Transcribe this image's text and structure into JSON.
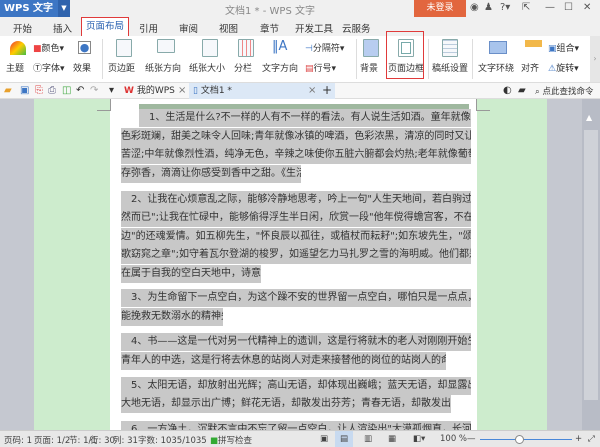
{
  "app": {
    "name": "WPS 文字",
    "title": "文档1 * - WPS 文字",
    "login": "未登录"
  },
  "tabs": [
    "开始",
    "插入",
    "页面布局",
    "引用",
    "审阅",
    "视图",
    "章节",
    "开发工具",
    "云服务"
  ],
  "ribbon": {
    "theme": "主题",
    "color": "颜色",
    "font": "字体",
    "effect": "效果",
    "margin": "页边距",
    "orientation": "纸张方向",
    "size": "纸张大小",
    "columns": "分栏",
    "text_direction": "文字方向",
    "separator": "分隔符",
    "line_number": "行号",
    "background": "背景",
    "page_border": "页面边框",
    "manuscript": "稿纸设置",
    "wrap": "文字环绕",
    "align": "对齐",
    "group": "组合",
    "rotate": "旋转"
  },
  "doc_tabs": {
    "my_wps": "我的WPS",
    "doc": "文档1 *",
    "search_placeholder": "点此查找命令"
  },
  "document": {
    "lines": [
      "　1、生活是什么?不一样的人有不一样的看法。有人说生活如酒。童年就像鸡尾酒，",
      "色彩斑斓，甜美之味令人回味;青年就像冰镇的啤酒，色彩浓黑，清凉的同时又让人觉得",
      "苦涩;中年就像烈性酒，纯净无色，辛辣之味使你五脏六腑都会灼热;老年就像葡萄酒，久",
      "存弥香，滴滴让你感受到香中之甜。《生活是什么》",
      "　2、让我在心烦意乱之际，能够冷静地思考，吟上一句\"人生天地间，若白驹过隙，忽",
      "然而已\";让我在忙碌中，能够偷得浮生半日闲，欣赏一段\"他年傥得蟾宫客，不在梅边在柳",
      "边\"的还魂爱情。如五柳先生，\"怀良辰以孤往，或植杖而耘耔\";如东坡先生，\"颂明月之诗，",
      "歌窈窕之章\";如守着瓦尔登湖的梭罗，如遥望乞力马扎罗之雪的海明威。他们都是诗人，",
      "在属于自我的空白天地中，诗意地栖居。",
      "　3、为生命留下一点空白，为这个躁不安的世界留一点空白，哪怕只是一点点，却",
      "能挽救无数溺水的精神失陷者。",
      "　4、书——这是一代对另一代精神上的遗训，这是行将就木的老人对刚刚开始生活的",
      "青年人的中选，这是行将去休息的站岗人对走来接替他的岗位的站岗人的命令。",
      "　5、太阳无语，却放射出光辉；高山无语，却体现出巍峨；蓝天无语，却显露出高远；",
      "大地无语，却显示出广博；鲜花无语，却散发出芬芳；青春无语，却散发出活力。",
      "　6、一方净土，沉默不言中不忘了留一点空白，让人渲染出\"大漠孤烟直，长河落日圆\""
    ]
  },
  "status": {
    "page": "页码: 1",
    "pages": "页面: 1/2",
    "section": "节: 1/1",
    "row": "行: 30",
    "col": "列: 31",
    "words": "字数: 1035/1035",
    "spell": "拼写检查",
    "zoom": "100 %"
  },
  "colors": {
    "accent": "#3d76c4",
    "login": "#e2663e",
    "highlight": "#e03a3a",
    "doc_bg": "#cdeccd"
  },
  "zoom_percent": 100
}
